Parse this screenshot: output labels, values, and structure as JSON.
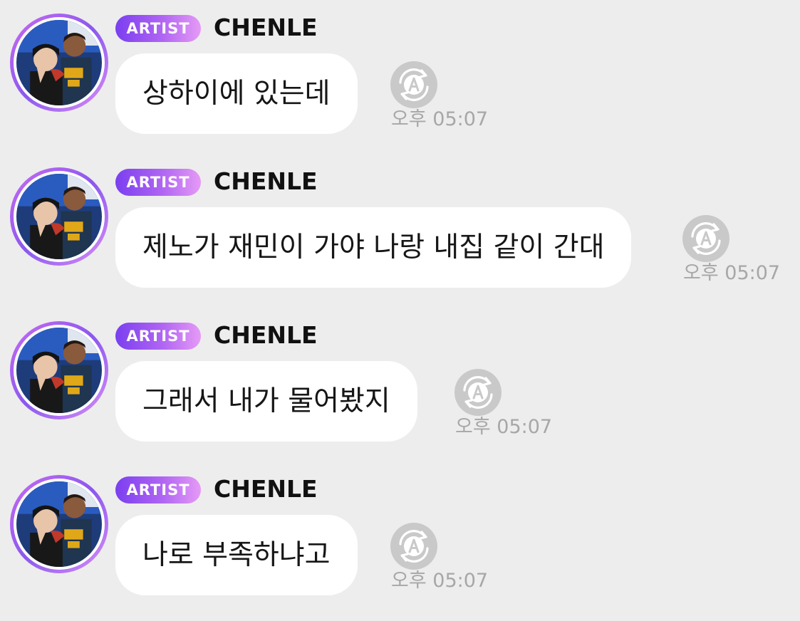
{
  "messages": [
    {
      "badge": "ARTIST",
      "name": "CHENLE",
      "text": "상하이에 있는데",
      "time": "오후 05:07",
      "translate_icon": "auto-translate-icon"
    },
    {
      "badge": "ARTIST",
      "name": "CHENLE",
      "text": "제노가 재민이 가야 나랑 내집 같이 간대",
      "time": "오후 05:07",
      "translate_icon": "auto-translate-icon"
    },
    {
      "badge": "ARTIST",
      "name": "CHENLE",
      "text": "그래서 내가 물어봤지",
      "time": "오후 05:07",
      "translate_icon": "auto-translate-icon"
    },
    {
      "badge": "ARTIST",
      "name": "CHENLE",
      "text": "나로 부족하냐고",
      "time": "오후 05:07",
      "translate_icon": "auto-translate-icon"
    }
  ],
  "colors": {
    "background": "#ededed",
    "bubble": "#ffffff",
    "badge_start": "#7a3ff0",
    "badge_end": "#e59af6",
    "timestamp": "#a7a7a7",
    "icon": "#c9c9c9"
  }
}
